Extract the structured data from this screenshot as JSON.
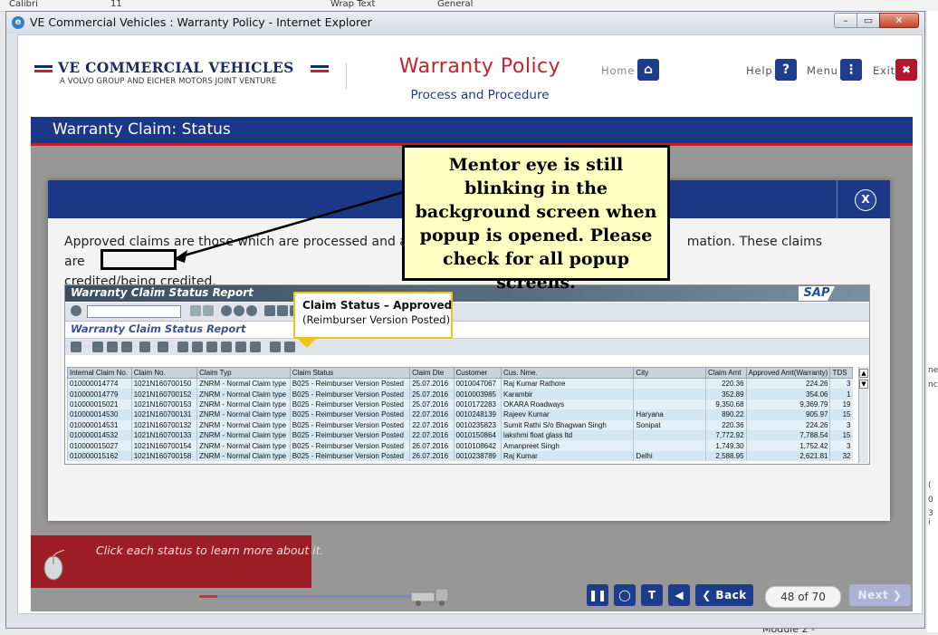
{
  "excel_bg": {
    "font_name": "Calibri",
    "font_size": "11",
    "wrap_text": "Wrap Text",
    "number_format": "General",
    "right_edge_texts": [
      "ne",
      "nc",
      "(",
      "0",
      "3 i"
    ],
    "module_label": "Module 2 -"
  },
  "window": {
    "title": "VE Commercial Vehicles : Warranty Policy - Internet Explorer",
    "min_glyph": "–",
    "max_glyph": "▭",
    "close_glyph": "✕"
  },
  "header": {
    "brand_name": "VE COMMERCIAL VEHICLES",
    "brand_tagline": "A VOLVO GROUP AND EICHER MOTORS JOINT VENTURE",
    "course_title": "Warranty Policy",
    "course_subtitle": "Process and Procedure",
    "home_label": "Home",
    "help_label": "Help",
    "menu_label": "Menu",
    "exit_label": "Exit",
    "home_glyph": "⌂",
    "help_glyph": "?",
    "menu_glyph": "⋮",
    "exit_glyph": "✖"
  },
  "page": {
    "section_title": "Warranty Claim: Status",
    "hint": "Click each status to learn more about it."
  },
  "popup": {
    "close_label": "X",
    "description": "Approved claims are those which are processed and accepted... information. These claims are credited/being credited.",
    "description_visible_part1": "Approved claims are those which are processed and accep",
    "description_visible_part2": "mation. These claims are",
    "description_line2": "credited/being credited."
  },
  "sap": {
    "window_title": "Warranty Claim Status Report",
    "report_title": "Warranty Claim Status Report",
    "logo": "SAP",
    "columns": [
      "Internal Claim No.",
      "Claim No.",
      "Claim Typ",
      "Claim Status",
      "Claim Dte",
      "Customer",
      "Cus. Nme.",
      "City",
      "Claim Amt",
      "Approved Amt(Warranty)",
      "TDS"
    ],
    "rows": [
      [
        "010000014774",
        "1021N160700150",
        "ZNRM - Normal Claim type",
        "B025 - Reimburser Version Posted",
        "25.07.2016",
        "0010047067",
        "Raj Kumar Rathore",
        "",
        "220.36",
        "224.26",
        "3"
      ],
      [
        "010000014779",
        "1021N160700152",
        "ZNRM - Normal Claim type",
        "B025 - Reimburser Version Posted",
        "25.07.2016",
        "0010003985",
        "Karambir",
        "",
        "352.89",
        "354.06",
        "1"
      ],
      [
        "010000015021",
        "1021N160700153",
        "ZNRM - Normal Claim type",
        "B025 - Reimburser Version Posted",
        "25.07.2016",
        "0010172283",
        "OKARA Roadways",
        "",
        "9,350.68",
        "9,369.79",
        "19"
      ],
      [
        "010000014530",
        "1021N160700131",
        "ZNRM - Normal Claim type",
        "B025 - Reimburser Version Posted",
        "22.07.2016",
        "0010248139",
        "Rajeev Kumar",
        "Haryana",
        "890.22",
        "905.97",
        "15"
      ],
      [
        "010000014531",
        "1021N160700132",
        "ZNRM - Normal Claim type",
        "B025 - Reimburser Version Posted",
        "22.07.2016",
        "0010235823",
        "Sumit Rathi S/o  Bhagwan Singh",
        "Sonipat",
        "220.36",
        "224.26",
        "3"
      ],
      [
        "010000014532",
        "1021N160700133",
        "ZNRM - Normal Claim type",
        "B025 - Reimburser Version Posted",
        "22.07.2016",
        "0010150864",
        "lakshmi float glass ltd",
        "",
        "7,772.92",
        "7,788.54",
        "15"
      ],
      [
        "010000015027",
        "1021N160700154",
        "ZNRM - Normal Claim type",
        "B025 - Reimburser Version Posted",
        "26.07.2016",
        "0010108642",
        "Amanpreet Singh",
        "",
        "1,749.30",
        "1,752.42",
        "3"
      ],
      [
        "010000015162",
        "1021N160700158",
        "ZNRM - Normal Claim type",
        "B025 - Reimburser Version Posted",
        "26.07.2016",
        "0010238789",
        "Raj Kumar",
        "Delhi",
        "2,588.95",
        "2,621.81",
        "32"
      ]
    ]
  },
  "callout": {
    "title": "Claim Status – Approved",
    "subtitle": "(Reimburser Version Posted)"
  },
  "annotation": {
    "text": "Mentor eye is still blinking in the background screen when popup is opened. Please check for all popup screens."
  },
  "footer": {
    "pause_glyph": "❚❚",
    "comment_glyph": "◯",
    "text_glyph": "T",
    "audio_glyph": "◀",
    "back_label": "❮ Back",
    "next_label": "Next ❯",
    "page_counter": "48 of 70"
  },
  "colors": {
    "brand_navy": "#1b3886",
    "brand_red": "#c21f2e",
    "callout_yellow": "#f2c21b",
    "annotation_bg": "#ffffc2"
  }
}
